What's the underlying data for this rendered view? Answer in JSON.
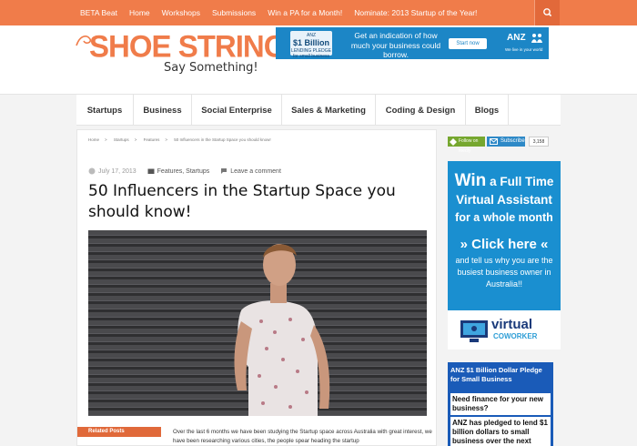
{
  "topbar": {
    "links": [
      "BETA Beat",
      "Home",
      "Workshops",
      "Submissions",
      "Win a PA for a Month!",
      "Nominate: 2013 Startup of the Year!"
    ]
  },
  "logo": {
    "main": "SHOE STRING",
    "tagline": "Say Something!"
  },
  "header_ad": {
    "card_top": "ANZ",
    "card_amount": "$1 Billion",
    "card_sub": "LENDING PLEDGE",
    "card_small": "for small business",
    "text": "Get an indication of how much your business could borrow.",
    "button": "Start now",
    "brand": "ANZ",
    "brand_sub": "We live in your world"
  },
  "mainnav": {
    "items": [
      "Startups",
      "Business",
      "Social Enterprise",
      "Sales & Marketing",
      "Coding & Design",
      "Blogs"
    ]
  },
  "breadcrumb": {
    "items": [
      "Home",
      "Startups",
      "Features",
      "50 Influencers in the Startup Space you should know!"
    ],
    "sep": ">"
  },
  "post": {
    "date": "July 17, 2013",
    "categories": "Features, Startups",
    "comment": "Leave a comment",
    "title": "50 Influencers in the Startup Space you should know!",
    "excerpt": "Over the last 6 months we have been studying the Startup space across Australia with great interest, we have been researching various cities, the people spear heading the startup"
  },
  "related": {
    "label": "Related Posts"
  },
  "social": {
    "follow": "Follow on feedly",
    "subscribe": "Subscribe",
    "count": "3,158"
  },
  "side_ad": {
    "line1_win": "Win",
    "line1_rest": "a Full Time",
    "line2": "Virtual Assistant",
    "line3": "for a whole month",
    "click": "» Click here «",
    "body": "and tell us why you are the busiest business owner in Australia!!",
    "logo_main": "virtual",
    "logo_sub": "COWORKER"
  },
  "side_ad2": {
    "heading": "ANZ $1 Billion Dollar Pledge for Small Business",
    "q": "Need finance for your new business?",
    "a": "ANZ has pledged to lend $1 billion dollars to small business over the next"
  },
  "colors": {
    "brand": "#f07c4a",
    "link_blue": "#1a8fd0",
    "anz_blue": "#1c86c6"
  }
}
